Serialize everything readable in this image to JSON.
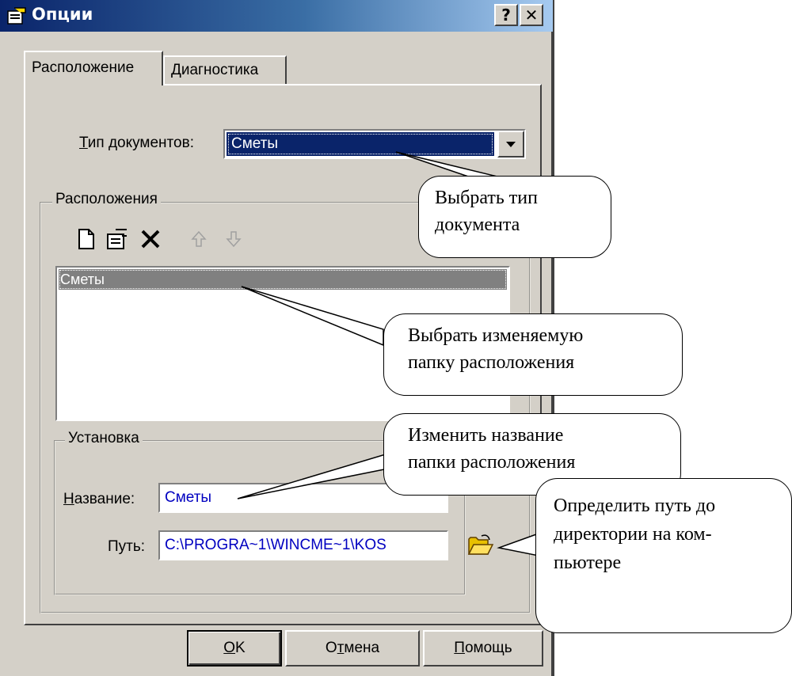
{
  "window": {
    "title": "Опции",
    "help_btn": "?",
    "close_btn": "✕"
  },
  "tabs": [
    {
      "label": "Расположение",
      "active": true
    },
    {
      "label": "Диагностика",
      "active": false
    }
  ],
  "doc_type": {
    "label_prefix": "",
    "label_mnemonic": "Т",
    "label_rest": "ип документов:",
    "value": "Сметы"
  },
  "locations_group": {
    "title": "Расположения",
    "toolbar": [
      "new-icon",
      "properties-icon",
      "delete-icon",
      "move-up-icon",
      "move-down-icon"
    ],
    "items": [
      "Сметы"
    ]
  },
  "setup_group": {
    "title": "Установка",
    "name_label_mnemonic": "Н",
    "name_label_rest": "азвание:",
    "name_value": "Сметы",
    "path_label": "Путь:",
    "path_value": "C:\\PROGRA~1\\WINCME~1\\KOS"
  },
  "buttons": {
    "ok_mnemonic": "O",
    "ok_rest": "K",
    "cancel_prefix": "О",
    "cancel_mnemonic": "т",
    "cancel_rest": "мена",
    "help_mnemonic": "П",
    "help_rest": "омощь"
  },
  "callouts": {
    "c1_line1": "Выбрать тип",
    "c1_line2": "документа",
    "c2_line1": "Выбрать изменяемую",
    "c2_line2": "папку расположения",
    "c3_line1": "Изменить название",
    "c3_line2": "папки расположения",
    "c4_line1": "Определить путь до",
    "c4_line2": "директории на ком-",
    "c4_line3": "пьютере"
  }
}
